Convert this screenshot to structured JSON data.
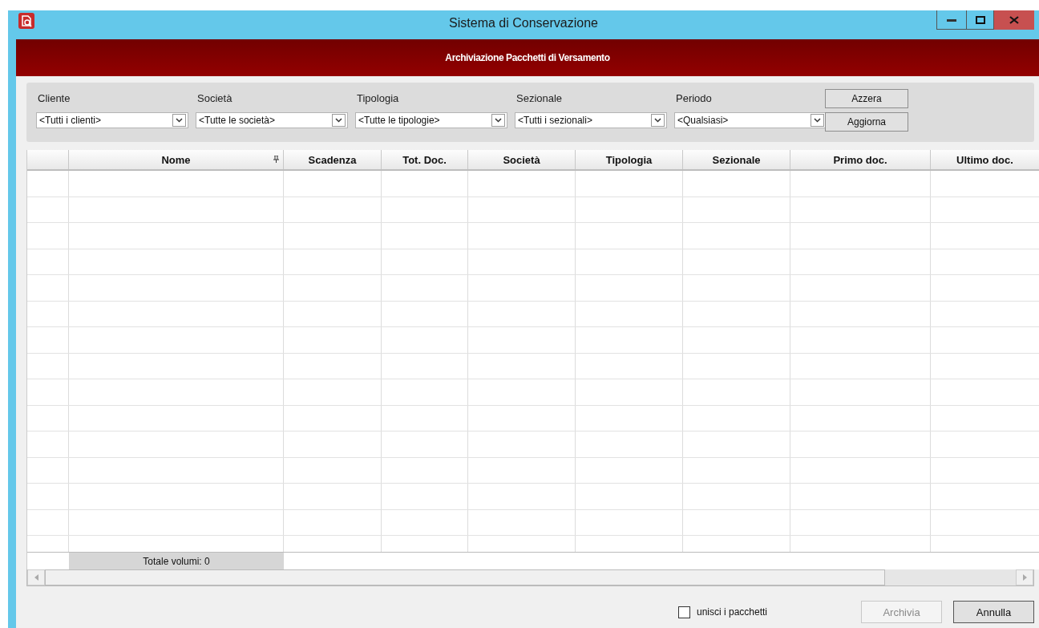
{
  "window": {
    "title": "Sistema di Conservazione"
  },
  "header": "Archiviazione Pacchetti di Versamento",
  "filters": [
    {
      "label": "Cliente",
      "value": "<Tutti i clienti>"
    },
    {
      "label": "Società",
      "value": "<Tutte le società>"
    },
    {
      "label": "Tipologia",
      "value": "<Tutte le tipologie>"
    },
    {
      "label": "Sezionale",
      "value": "<Tutti i sezionali>"
    },
    {
      "label": "Periodo",
      "value": "<Qualsiasi>"
    }
  ],
  "filter_buttons": [
    "Azzera",
    "Aggiorna"
  ],
  "table": {
    "columns": [
      {
        "label": "Nome",
        "kind": "pinned"
      },
      {
        "label": "Scadenza",
        "kind": "plain"
      },
      {
        "label": "Tot. Doc.",
        "kind": "plain"
      },
      {
        "label": "Società",
        "kind": "plain"
      },
      {
        "label": "Tipologia",
        "kind": "plain"
      },
      {
        "label": "Sezionale",
        "kind": "plain"
      },
      {
        "label": "Primo doc.",
        "kind": "plain"
      },
      {
        "label": "Ultimo doc.",
        "kind": "plain"
      }
    ],
    "total": "Totale volumi: 0"
  },
  "merge_option": {
    "label": "unisci i pacchetti",
    "checked": false
  },
  "buttons": [
    {
      "label": "Archivia",
      "disabled": true
    },
    {
      "label": "Annulla",
      "disabled": false
    }
  ]
}
